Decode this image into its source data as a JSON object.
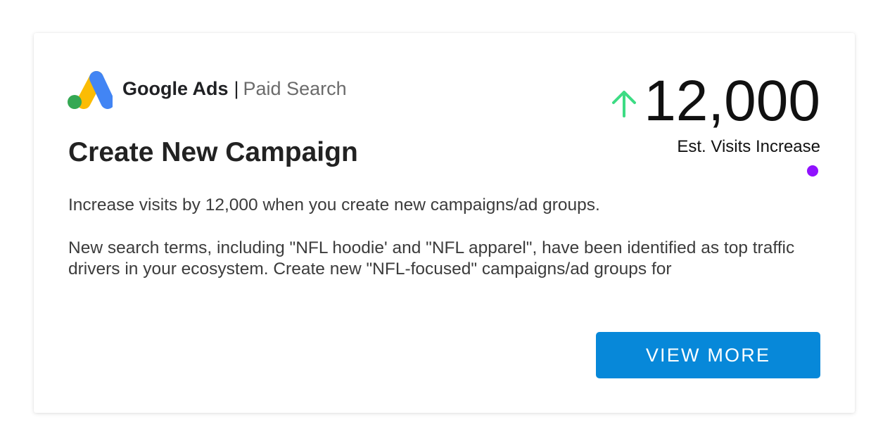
{
  "brand": {
    "name": "Google Ads",
    "separator": "|",
    "channel": "Paid Search",
    "logo_icon": "google-ads-logo"
  },
  "card": {
    "title": "Create New Campaign",
    "description_1": "Increase visits by 12,000 when you create new campaigns/ad groups.",
    "description_2": "New search terms, including \"NFL hoodie' and \"NFL apparel\", have been identified as top traffic drivers in your ecosystem. Create new \"NFL-focused\" campaigns/ad groups for"
  },
  "metric": {
    "value": "12,000",
    "label": "Est. Visits Increase",
    "trend_icon": "up-arrow-icon",
    "trend_color": "#3ddc84",
    "status_color": "#9012fe"
  },
  "actions": {
    "view_more_label": "VIEW MORE",
    "button_color": "#0788d9"
  }
}
